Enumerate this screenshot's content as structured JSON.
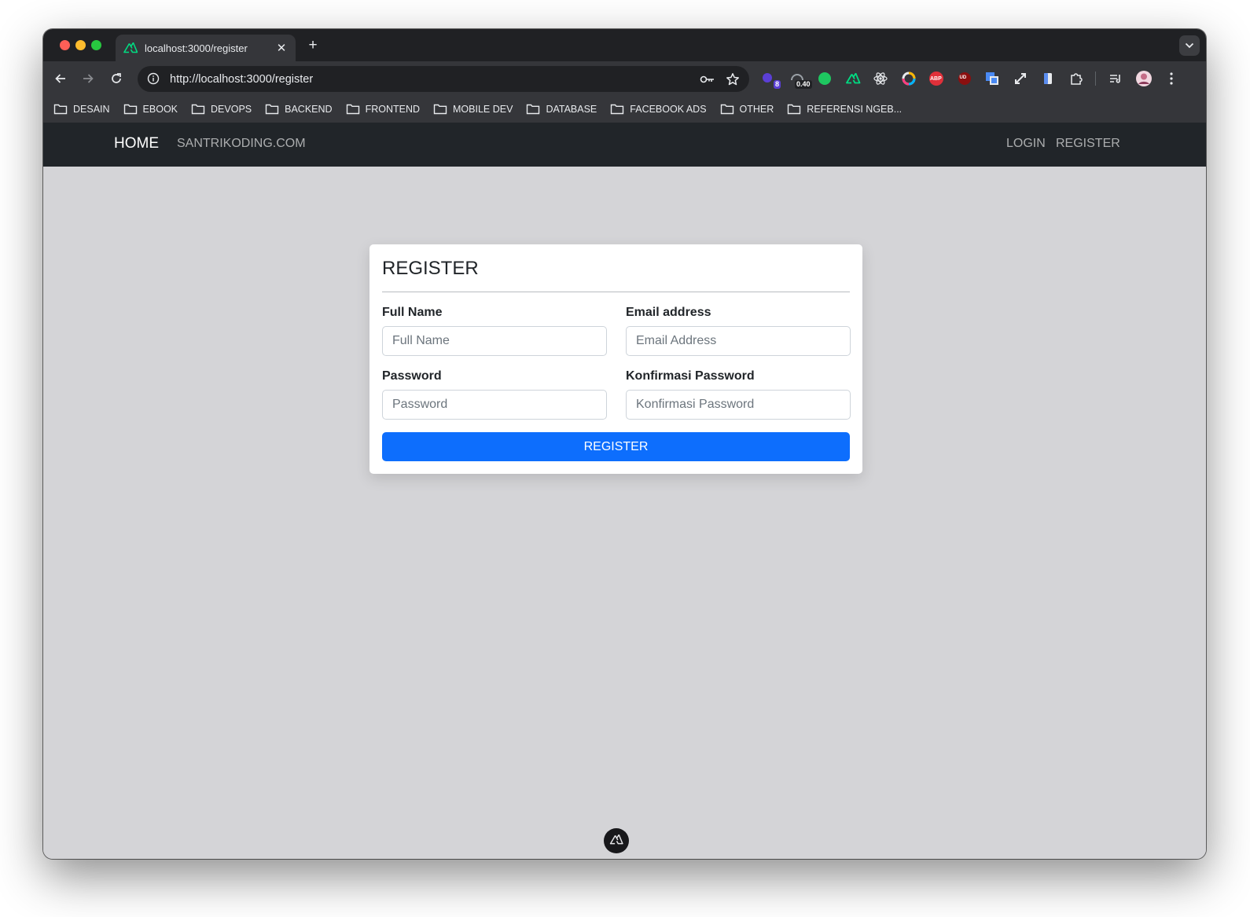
{
  "browser": {
    "tab": {
      "title": "localhost:3000/register"
    },
    "address_bar": {
      "url": "http://localhost:3000/register"
    },
    "extensions": [
      {
        "icon": "puzzle-purple-icon",
        "badge": "8"
      },
      {
        "icon": "speed-meter-icon",
        "badge": "0.40"
      },
      {
        "icon": "green-dot-icon"
      },
      {
        "icon": "nuxt-icon"
      },
      {
        "icon": "react-icon"
      },
      {
        "icon": "color-ring-icon"
      },
      {
        "icon": "adblock-icon",
        "label": "ABP"
      },
      {
        "icon": "ublock-icon",
        "label": "UD"
      },
      {
        "icon": "translate-icon"
      },
      {
        "icon": "expand-icon"
      },
      {
        "icon": "clipboard-icon"
      },
      {
        "icon": "extensions-icon"
      }
    ],
    "bookmarks": [
      "DESAIN",
      "EBOOK",
      "DEVOPS",
      "BACKEND",
      "FRONTEND",
      "MOBILE DEV",
      "DATABASE",
      "FACEBOOK ADS",
      "OTHER",
      "REFERENSI NGEB..."
    ],
    "colors": {
      "tabstrip": "#202124",
      "toolbar": "#35363a",
      "accent_nuxt": "#00dc82"
    }
  },
  "navbar": {
    "brand": "HOME",
    "link_left": "SANTRIKODING.COM",
    "link_login": "LOGIN",
    "link_register": "REGISTER"
  },
  "form": {
    "title": "REGISTER",
    "full_name": {
      "label": "Full Name",
      "placeholder": "Full Name",
      "value": ""
    },
    "email": {
      "label": "Email address",
      "placeholder": "Email Address",
      "value": ""
    },
    "password": {
      "label": "Password",
      "placeholder": "Password",
      "value": ""
    },
    "confirm_password": {
      "label": "Konfirmasi Password",
      "placeholder": "Konfirmasi Password",
      "value": ""
    },
    "submit_label": "REGISTER",
    "colors": {
      "primary": "#0d6efd",
      "page_bg": "#d4d4d7",
      "navbar_bg": "#212529"
    }
  }
}
